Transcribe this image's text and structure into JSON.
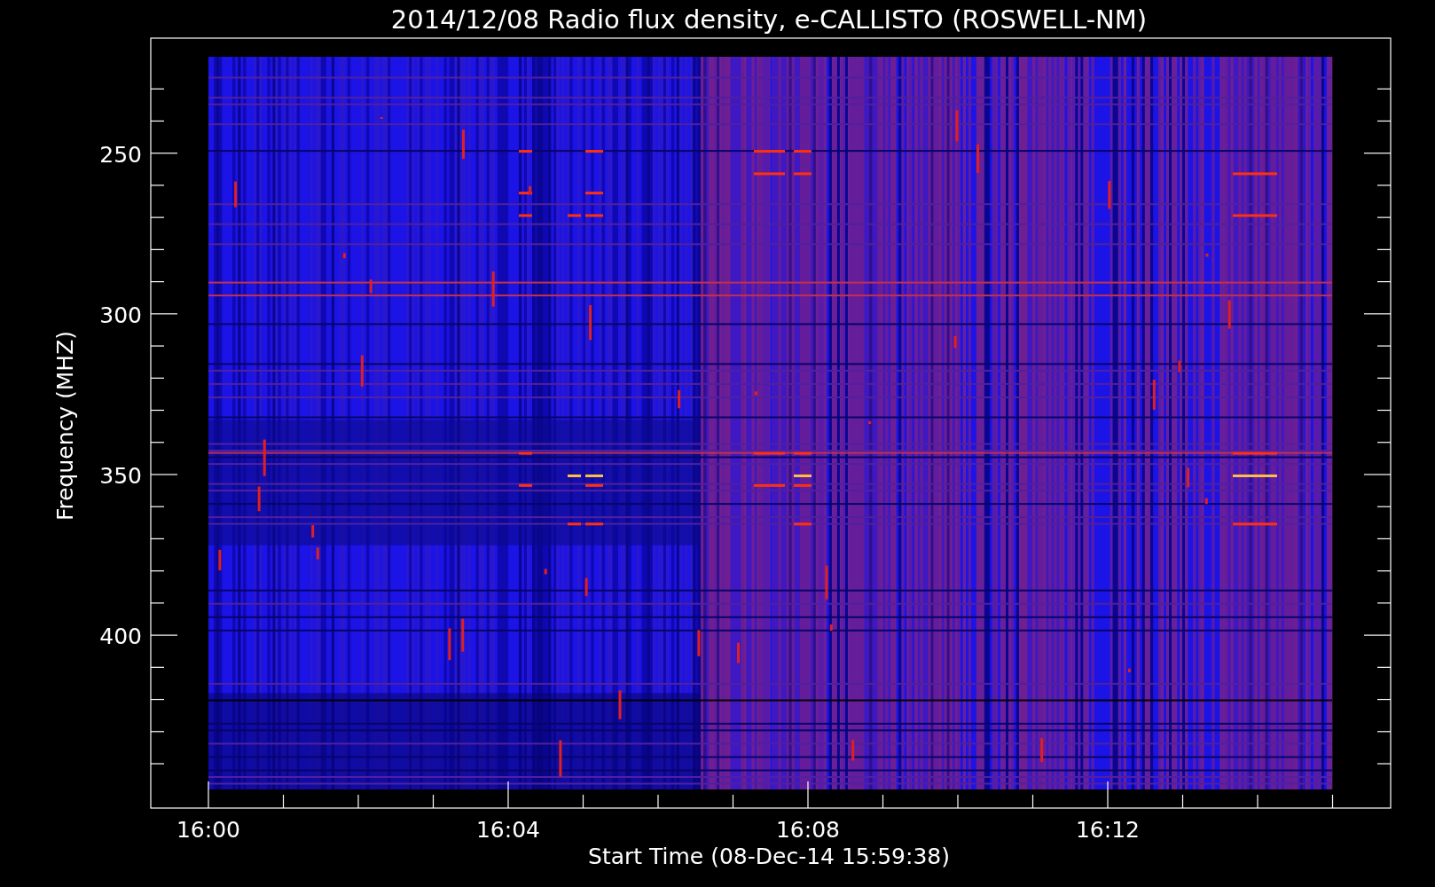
{
  "plot": {
    "title": "2014/12/08  Radio flux density, e-CALLISTO (ROSWELL-NM)",
    "ylabel": "Frequency (MHZ)",
    "xlabel": "Start Time (08-Dec-14 15:59:38)",
    "yticks": [
      "250",
      "300",
      "350",
      "400"
    ],
    "xticks": [
      "16:00",
      "16:04",
      "16:08",
      "16:12"
    ]
  }
}
